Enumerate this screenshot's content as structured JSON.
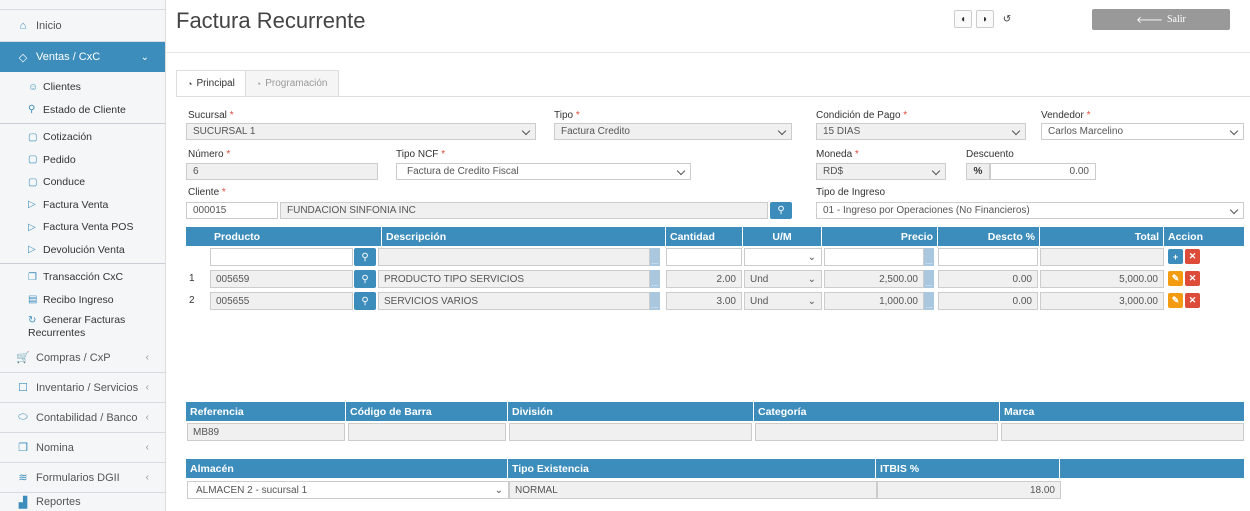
{
  "sidebar": {
    "inicio": "Inicio",
    "ventas": "Ventas / CxC",
    "sub": [
      "Clientes",
      "Estado de Cliente",
      "Cotización",
      "Pedido",
      "Conduce",
      "Factura Venta",
      "Factura Venta POS",
      "Devolución Venta",
      "Transacción CxC",
      "Recibo Ingreso",
      "Generar Facturas Recurrentes"
    ],
    "compras": "Compras / CxP",
    "inventario": "Inventario / Servicios",
    "contabilidad": "Contabilidad / Banco",
    "nomina": "Nomina",
    "formularios": "Formularios DGII",
    "reportes": "Reportes"
  },
  "page": {
    "title": "Factura Recurrente",
    "salir": "Salir"
  },
  "tabs": {
    "principal": "Principal",
    "programacion": "Programación"
  },
  "form": {
    "sucursal_label": "Sucursal",
    "sucursal": "SUCURSAL 1",
    "tipo_label": "Tipo",
    "tipo": "Factura Credito",
    "condicion_label": "Condición de Pago",
    "condicion": "15 DIAS",
    "vendedor_label": "Vendedor",
    "vendedor": "Carlos Marcelino",
    "numero_label": "Número",
    "numero": "6",
    "tipo_ncf_label": "Tipo NCF",
    "tipo_ncf": "Factura de Credito Fiscal",
    "moneda_label": "Moneda",
    "moneda": "RD$",
    "descuento_label": "Descuento",
    "descuento_symbol": "%",
    "descuento": "0.00",
    "cliente_label": "Cliente",
    "cliente_codigo": "000015",
    "cliente_nombre": "FUNDACION SINFONIA INC",
    "tipo_ingreso_label": "Tipo de Ingreso",
    "tipo_ingreso": "01 - Ingreso por Operaciones (No Financieros)"
  },
  "items": {
    "headers": {
      "producto": "Producto",
      "descripcion": "Descripción",
      "cantidad": "Cantidad",
      "um": "U/M",
      "precio": "Precio",
      "descto": "Descto %",
      "total": "Total",
      "accion": "Accion"
    },
    "rows": [
      {
        "n": "1",
        "codigo": "005659",
        "descripcion": "PRODUCTO TIPO SERVICIOS",
        "cantidad": "2.00",
        "um": "Und",
        "precio": "2,500.00",
        "descto": "0.00",
        "total": "5,000.00"
      },
      {
        "n": "2",
        "codigo": "005655",
        "descripcion": "SERVICIOS VARIOS",
        "cantidad": "3.00",
        "um": "Und",
        "precio": "1,000.00",
        "descto": "0.00",
        "total": "3,000.00"
      }
    ]
  },
  "detalle": {
    "headers": {
      "referencia": "Referencia",
      "codigo_barra": "Código de Barra",
      "division": "División",
      "categoria": "Categoría",
      "marca": "Marca"
    },
    "referencia": "MB89"
  },
  "almacen": {
    "headers": {
      "almacen": "Almacén",
      "tipo_existencia": "Tipo Existencia",
      "itbis": "ITBIS %"
    },
    "almacen": "ALMACEN 2 - sucursal 1",
    "tipo_existencia": "NORMAL",
    "itbis": "18.00"
  }
}
